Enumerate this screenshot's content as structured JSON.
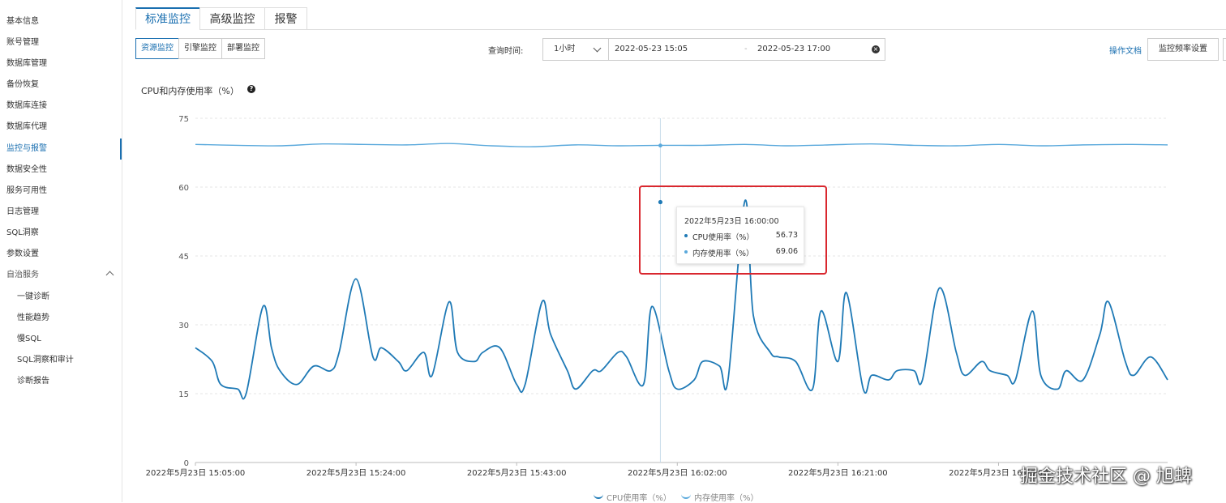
{
  "sidebar": {
    "items": [
      {
        "label": "基本信息"
      },
      {
        "label": "账号管理"
      },
      {
        "label": "数据库管理"
      },
      {
        "label": "备份恢复"
      },
      {
        "label": "数据库连接"
      },
      {
        "label": "数据库代理"
      },
      {
        "label": "监控与报警"
      },
      {
        "label": "数据安全性"
      },
      {
        "label": "服务可用性"
      },
      {
        "label": "日志管理"
      },
      {
        "label": "SQL洞察"
      },
      {
        "label": "参数设置"
      }
    ],
    "group": {
      "label": "自治服务"
    },
    "sub_items": [
      {
        "label": "一键诊断"
      },
      {
        "label": "性能趋势"
      },
      {
        "label": "慢SQL"
      },
      {
        "label": "SQL洞察和审计"
      },
      {
        "label": "诊断报告"
      }
    ]
  },
  "tabs": [
    {
      "label": "标准监控"
    },
    {
      "label": "高级监控"
    },
    {
      "label": "报警"
    }
  ],
  "subtabs": [
    {
      "label": "资源监控"
    },
    {
      "label": "引擎监控"
    },
    {
      "label": "部署监控"
    }
  ],
  "query": {
    "label": "查询时间:",
    "range_select": "1小时",
    "start": "2022-05-23 15:05",
    "separator": "-",
    "end": "2022-05-23 17:00"
  },
  "toolbar": {
    "doc_link": "操作文档",
    "rate_button": "监控频率设置"
  },
  "colors": {
    "accent": "#1a6fb0",
    "cpu": "#1f7ab6",
    "mem": "#5aa9dc",
    "highlight": "#d9272e"
  },
  "chart_data": {
    "type": "line",
    "title": "CPU和内存使用率（%）",
    "ylim": [
      0,
      75
    ],
    "yticks": [
      "0",
      "15",
      "30",
      "45",
      "60",
      "75"
    ],
    "xticks": [
      "2022年5月23日 15:05:00",
      "2022年5月23日 15:24:00",
      "2022年5月23日 15:43:00",
      "2022年5月23日 16:02:00",
      "2022年5月23日 16:21:00",
      "2022年5月23日 16:40:00"
    ],
    "xlim_minutes": [
      0,
      115
    ],
    "grid": true,
    "legend_position": "bottom",
    "series": [
      {
        "name": "CPU使用率（%）",
        "x": [
          0,
          2,
          3,
          5,
          6,
          8,
          9,
          10,
          12,
          14,
          16,
          17,
          19,
          21,
          22,
          24,
          25,
          27,
          28,
          30,
          31,
          33,
          34,
          36,
          38,
          39,
          41,
          42,
          44,
          45,
          47,
          48,
          50,
          51,
          53,
          54,
          56,
          57,
          59,
          60,
          62,
          63,
          65,
          66,
          68,
          69,
          71,
          73,
          74,
          76,
          77,
          79,
          80,
          82,
          83,
          85,
          86,
          88,
          90,
          91,
          93,
          94,
          96,
          97,
          99,
          100,
          102,
          103,
          105,
          107,
          108,
          110,
          111,
          113,
          115
        ],
        "values": [
          25,
          22,
          17,
          16,
          15,
          34,
          25,
          20,
          17,
          21,
          20,
          24,
          40,
          23,
          25,
          22,
          20,
          24,
          19,
          35,
          24,
          22,
          24,
          25,
          17,
          17,
          35,
          28,
          20,
          16,
          20,
          20,
          24,
          23,
          17,
          34,
          20,
          16,
          18,
          22,
          21,
          18,
          57,
          32,
          24,
          23,
          22,
          16,
          33,
          22,
          37,
          16,
          19,
          18,
          20,
          20,
          18,
          38,
          24,
          19,
          22,
          20,
          19,
          18,
          33,
          19,
          16,
          20,
          18,
          28,
          35,
          22,
          19,
          23,
          18
        ],
        "points_note": ""
      },
      {
        "name": "内存使用率（%）",
        "x": [
          0,
          5,
          10,
          15,
          20,
          25,
          30,
          35,
          40,
          45,
          50,
          55,
          60,
          65,
          70,
          75,
          80,
          85,
          90,
          95,
          100,
          105,
          110,
          115
        ],
        "values": [
          69.3,
          69.1,
          69.0,
          69.4,
          69.3,
          69.2,
          69.5,
          69.0,
          68.8,
          69.2,
          69.0,
          69.1,
          69.1,
          69.3,
          69.0,
          69.2,
          69.4,
          69.1,
          69.0,
          69.3,
          69.0,
          69.2,
          69.3,
          69.2
        ]
      }
    ],
    "tooltip": {
      "time": "2022年5月23日 16:00:00",
      "rows": [
        {
          "name": "CPU使用率（%）",
          "value": "56.73"
        },
        {
          "name": "内存使用率（%）",
          "value": "69.06"
        }
      ]
    }
  },
  "watermark": "掘金技术社区 @ 旭蜱"
}
